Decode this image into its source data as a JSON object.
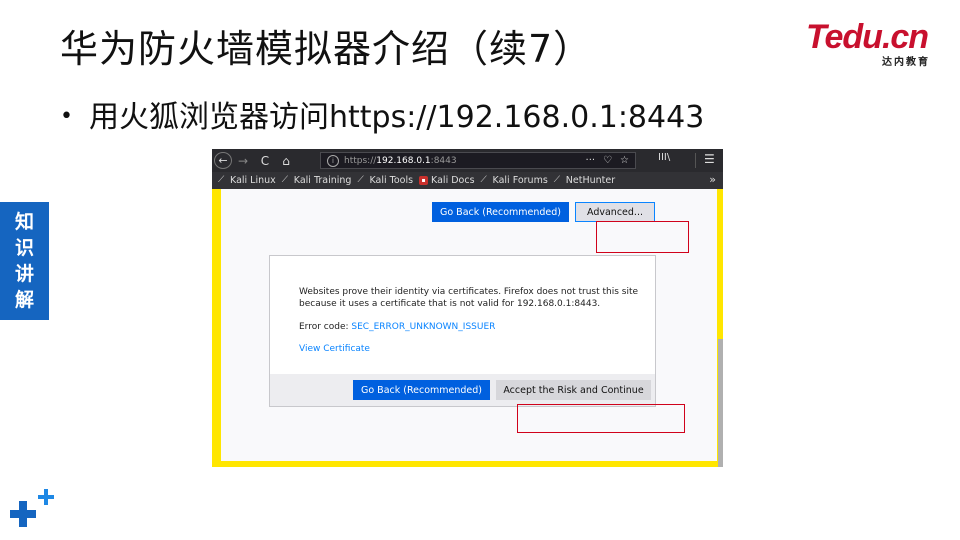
{
  "slide": {
    "title": "华为防火墙模拟器介绍（续7）",
    "bullet": "用火狐浏览器访问https://192.168.0.1:8443",
    "side_tab": [
      "知",
      "识",
      "讲",
      "解"
    ]
  },
  "logo": {
    "brand_main": "Tedu",
    "brand_dot": ".cn",
    "tagline": "达内教育"
  },
  "browser": {
    "url_scheme": "https://",
    "url_host": "192.168.0.1",
    "url_port": ":8443",
    "bookmarks": [
      "Kali Linux",
      "Kali Training",
      "Kali Tools",
      "Kali Docs",
      "Kali Forums",
      "NetHunter"
    ],
    "icons": {
      "back": "←",
      "forward": "→",
      "reload": "C",
      "home": "⌂",
      "info": "i",
      "more": "···",
      "pocket": "♡",
      "star": "☆",
      "library": "III\\",
      "menu": "☰",
      "overflow": "»"
    }
  },
  "page": {
    "go_back_label": "Go Back (Recommended)",
    "advanced_label": "Advanced...",
    "warning_text": "Websites prove their identity via certificates. Firefox does not trust this site because it uses a certificate that is not valid for 192.168.0.1:8443.",
    "error_code_prefix": "Error code: ",
    "error_code": "SEC_ERROR_UNKNOWN_ISSUER",
    "view_certificate": "View Certificate",
    "accept_label": "Accept the Risk and Continue"
  },
  "colors": {
    "frame_yellow": "#ffe600",
    "primary_blue": "#0060df",
    "highlight_red": "#d0021b",
    "side_tab_blue": "#1565c0",
    "brand_red": "#c8102e"
  }
}
